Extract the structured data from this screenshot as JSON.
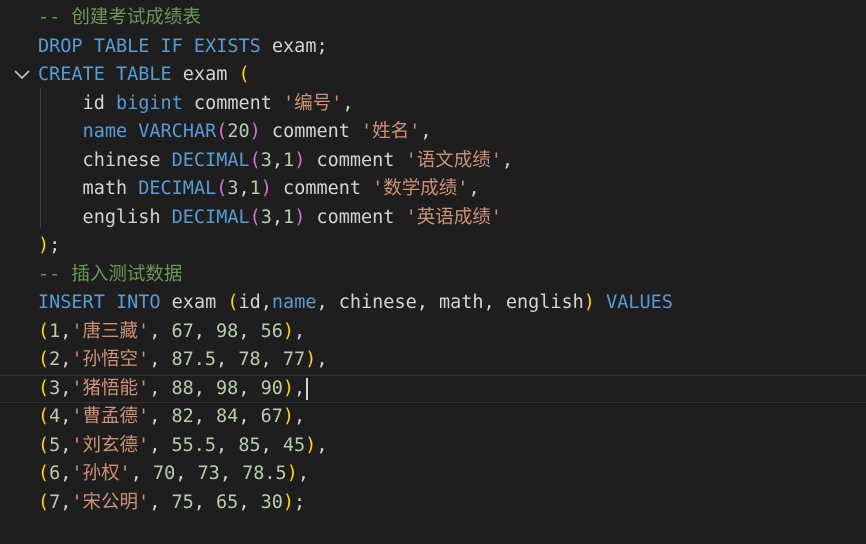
{
  "editor": {
    "background": "#1e1e1e",
    "fold_icon": "chevron-down-icon",
    "colors": {
      "comment": "#6a9955",
      "keyword": "#569cd6",
      "identifier": "#d4d4d4",
      "paren": "#ffd700",
      "paren_nested": "#da70d6",
      "number": "#b5cea8",
      "string": "#ce9178"
    },
    "lines": [
      {
        "tokens": [
          {
            "t": "comment",
            "v": "-- 创建考试成绩表"
          }
        ]
      },
      {
        "tokens": [
          {
            "t": "keyword",
            "v": "DROP TABLE IF EXISTS"
          },
          {
            "t": "ident",
            "v": " exam"
          },
          {
            "t": "punct",
            "v": ";"
          }
        ]
      },
      {
        "fold": true,
        "tokens": [
          {
            "t": "keyword",
            "v": "CREATE TABLE"
          },
          {
            "t": "ident",
            "v": " exam "
          },
          {
            "t": "paren",
            "v": "("
          }
        ]
      },
      {
        "tokens": [
          {
            "t": "ident",
            "v": "    id "
          },
          {
            "t": "keyword",
            "v": "bigint"
          },
          {
            "t": "ident",
            "v": " comment "
          },
          {
            "t": "string",
            "v": "'编号'"
          },
          {
            "t": "punct",
            "v": ","
          }
        ]
      },
      {
        "tokens": [
          {
            "t": "ident",
            "v": "    "
          },
          {
            "t": "keyword",
            "v": "name"
          },
          {
            "t": "ident",
            "v": " "
          },
          {
            "t": "keyword",
            "v": "VARCHAR"
          },
          {
            "t": "paren2",
            "v": "("
          },
          {
            "t": "number",
            "v": "20"
          },
          {
            "t": "paren2",
            "v": ")"
          },
          {
            "t": "ident",
            "v": " comment "
          },
          {
            "t": "string",
            "v": "'姓名'"
          },
          {
            "t": "punct",
            "v": ","
          }
        ]
      },
      {
        "tokens": [
          {
            "t": "ident",
            "v": "    chinese "
          },
          {
            "t": "keyword",
            "v": "DECIMAL"
          },
          {
            "t": "paren2",
            "v": "("
          },
          {
            "t": "number",
            "v": "3"
          },
          {
            "t": "punct",
            "v": ","
          },
          {
            "t": "number",
            "v": "1"
          },
          {
            "t": "paren2",
            "v": ")"
          },
          {
            "t": "ident",
            "v": " comment "
          },
          {
            "t": "string",
            "v": "'语文成绩'"
          },
          {
            "t": "punct",
            "v": ","
          }
        ]
      },
      {
        "tokens": [
          {
            "t": "ident",
            "v": "    math "
          },
          {
            "t": "keyword",
            "v": "DECIMAL"
          },
          {
            "t": "paren2",
            "v": "("
          },
          {
            "t": "number",
            "v": "3"
          },
          {
            "t": "punct",
            "v": ","
          },
          {
            "t": "number",
            "v": "1"
          },
          {
            "t": "paren2",
            "v": ")"
          },
          {
            "t": "ident",
            "v": " comment "
          },
          {
            "t": "string",
            "v": "'数学成绩'"
          },
          {
            "t": "punct",
            "v": ","
          }
        ]
      },
      {
        "tokens": [
          {
            "t": "ident",
            "v": "    english "
          },
          {
            "t": "keyword",
            "v": "DECIMAL"
          },
          {
            "t": "paren2",
            "v": "("
          },
          {
            "t": "number",
            "v": "3"
          },
          {
            "t": "punct",
            "v": ","
          },
          {
            "t": "number",
            "v": "1"
          },
          {
            "t": "paren2",
            "v": ")"
          },
          {
            "t": "ident",
            "v": " comment "
          },
          {
            "t": "string",
            "v": "'英语成绩'"
          }
        ]
      },
      {
        "tokens": [
          {
            "t": "paren",
            "v": ")"
          },
          {
            "t": "punct",
            "v": ";"
          }
        ]
      },
      {
        "tokens": [
          {
            "t": "comment",
            "v": "-- 插入测试数据"
          }
        ]
      },
      {
        "tokens": [
          {
            "t": "keyword",
            "v": "INSERT INTO"
          },
          {
            "t": "ident",
            "v": " exam "
          },
          {
            "t": "paren",
            "v": "("
          },
          {
            "t": "ident",
            "v": "id,"
          },
          {
            "t": "keyword",
            "v": "name"
          },
          {
            "t": "ident",
            "v": ", chinese, math, english"
          },
          {
            "t": "paren",
            "v": ")"
          },
          {
            "t": "ident",
            "v": " "
          },
          {
            "t": "keyword",
            "v": "VALUES"
          }
        ]
      },
      {
        "tokens": [
          {
            "t": "paren",
            "v": "("
          },
          {
            "t": "number",
            "v": "1"
          },
          {
            "t": "punct",
            "v": ","
          },
          {
            "t": "string",
            "v": "'唐三藏'"
          },
          {
            "t": "punct",
            "v": ", "
          },
          {
            "t": "number",
            "v": "67"
          },
          {
            "t": "punct",
            "v": ", "
          },
          {
            "t": "number",
            "v": "98"
          },
          {
            "t": "punct",
            "v": ", "
          },
          {
            "t": "number",
            "v": "56"
          },
          {
            "t": "paren",
            "v": ")"
          },
          {
            "t": "punct",
            "v": ","
          }
        ]
      },
      {
        "tokens": [
          {
            "t": "paren",
            "v": "("
          },
          {
            "t": "number",
            "v": "2"
          },
          {
            "t": "punct",
            "v": ","
          },
          {
            "t": "string",
            "v": "'孙悟空'"
          },
          {
            "t": "punct",
            "v": ", "
          },
          {
            "t": "number",
            "v": "87.5"
          },
          {
            "t": "punct",
            "v": ", "
          },
          {
            "t": "number",
            "v": "78"
          },
          {
            "t": "punct",
            "v": ", "
          },
          {
            "t": "number",
            "v": "77"
          },
          {
            "t": "paren",
            "v": ")"
          },
          {
            "t": "punct",
            "v": ","
          }
        ]
      },
      {
        "current": true,
        "cursor": true,
        "tokens": [
          {
            "t": "paren",
            "v": "("
          },
          {
            "t": "number",
            "v": "3"
          },
          {
            "t": "punct",
            "v": ","
          },
          {
            "t": "string",
            "v": "'猪悟能'"
          },
          {
            "t": "punct",
            "v": ", "
          },
          {
            "t": "number",
            "v": "88"
          },
          {
            "t": "punct",
            "v": ", "
          },
          {
            "t": "number",
            "v": "98"
          },
          {
            "t": "punct",
            "v": ", "
          },
          {
            "t": "number",
            "v": "90"
          },
          {
            "t": "paren",
            "v": ")"
          },
          {
            "t": "punct",
            "v": ","
          }
        ]
      },
      {
        "tokens": [
          {
            "t": "paren",
            "v": "("
          },
          {
            "t": "number",
            "v": "4"
          },
          {
            "t": "punct",
            "v": ","
          },
          {
            "t": "string",
            "v": "'曹孟德'"
          },
          {
            "t": "punct",
            "v": ", "
          },
          {
            "t": "number",
            "v": "82"
          },
          {
            "t": "punct",
            "v": ", "
          },
          {
            "t": "number",
            "v": "84"
          },
          {
            "t": "punct",
            "v": ", "
          },
          {
            "t": "number",
            "v": "67"
          },
          {
            "t": "paren",
            "v": ")"
          },
          {
            "t": "punct",
            "v": ","
          }
        ]
      },
      {
        "tokens": [
          {
            "t": "paren",
            "v": "("
          },
          {
            "t": "number",
            "v": "5"
          },
          {
            "t": "punct",
            "v": ","
          },
          {
            "t": "string",
            "v": "'刘玄德'"
          },
          {
            "t": "punct",
            "v": ", "
          },
          {
            "t": "number",
            "v": "55.5"
          },
          {
            "t": "punct",
            "v": ", "
          },
          {
            "t": "number",
            "v": "85"
          },
          {
            "t": "punct",
            "v": ", "
          },
          {
            "t": "number",
            "v": "45"
          },
          {
            "t": "paren",
            "v": ")"
          },
          {
            "t": "punct",
            "v": ","
          }
        ]
      },
      {
        "tokens": [
          {
            "t": "paren",
            "v": "("
          },
          {
            "t": "number",
            "v": "6"
          },
          {
            "t": "punct",
            "v": ","
          },
          {
            "t": "string",
            "v": "'孙权'"
          },
          {
            "t": "punct",
            "v": ", "
          },
          {
            "t": "number",
            "v": "70"
          },
          {
            "t": "punct",
            "v": ", "
          },
          {
            "t": "number",
            "v": "73"
          },
          {
            "t": "punct",
            "v": ", "
          },
          {
            "t": "number",
            "v": "78.5"
          },
          {
            "t": "paren",
            "v": ")"
          },
          {
            "t": "punct",
            "v": ","
          }
        ]
      },
      {
        "tokens": [
          {
            "t": "paren",
            "v": "("
          },
          {
            "t": "number",
            "v": "7"
          },
          {
            "t": "punct",
            "v": ","
          },
          {
            "t": "string",
            "v": "'宋公明'"
          },
          {
            "t": "punct",
            "v": ", "
          },
          {
            "t": "number",
            "v": "75"
          },
          {
            "t": "punct",
            "v": ", "
          },
          {
            "t": "number",
            "v": "65"
          },
          {
            "t": "punct",
            "v": ", "
          },
          {
            "t": "number",
            "v": "30"
          },
          {
            "t": "paren",
            "v": ")"
          },
          {
            "t": "punct",
            "v": ";"
          }
        ]
      }
    ]
  }
}
